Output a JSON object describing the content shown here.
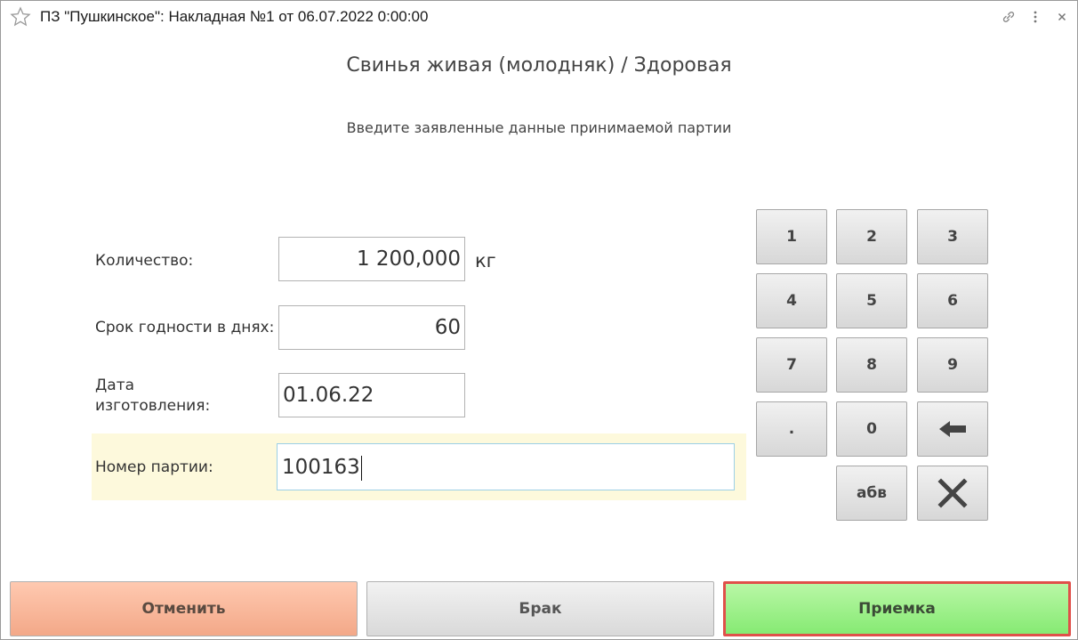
{
  "window": {
    "title": "ПЗ \"Пушкинское\": Накладная №1 от 06.07.2022 0:00:00",
    "icons": [
      "star-icon",
      "link-icon",
      "menu-icon",
      "close-icon"
    ]
  },
  "form": {
    "heading": "Свинья живая (молодняк) / Здоровая",
    "subheading": "Введите заявленные данные принимаемой партии",
    "quantity": {
      "label": "Количество:",
      "value": "1 200,000",
      "unit": "кг"
    },
    "shelf_life": {
      "label": "Срок годности в днях:",
      "value": "60"
    },
    "manufacture_date": {
      "label_line1": "Дата",
      "label_line2": "изготовления:",
      "value": "01.06.22"
    },
    "batch_number": {
      "label": "Номер партии:",
      "value": "100163"
    }
  },
  "keypad": {
    "keys": [
      "1",
      "2",
      "3",
      "4",
      "5",
      "6",
      "7",
      "8",
      "9",
      ".",
      "0"
    ],
    "backspace_icon": "arrow-left-icon",
    "letters_label": "абв",
    "clear_icon": "x-icon"
  },
  "actions": {
    "cancel_label": "Отменить",
    "defect_label": "Брак",
    "accept_label": "Приемка"
  },
  "colors": {
    "cancel": "#f3a888",
    "accept": "#86ea73",
    "accept_border": "#e0504a",
    "active_row": "#fdf9dc"
  }
}
